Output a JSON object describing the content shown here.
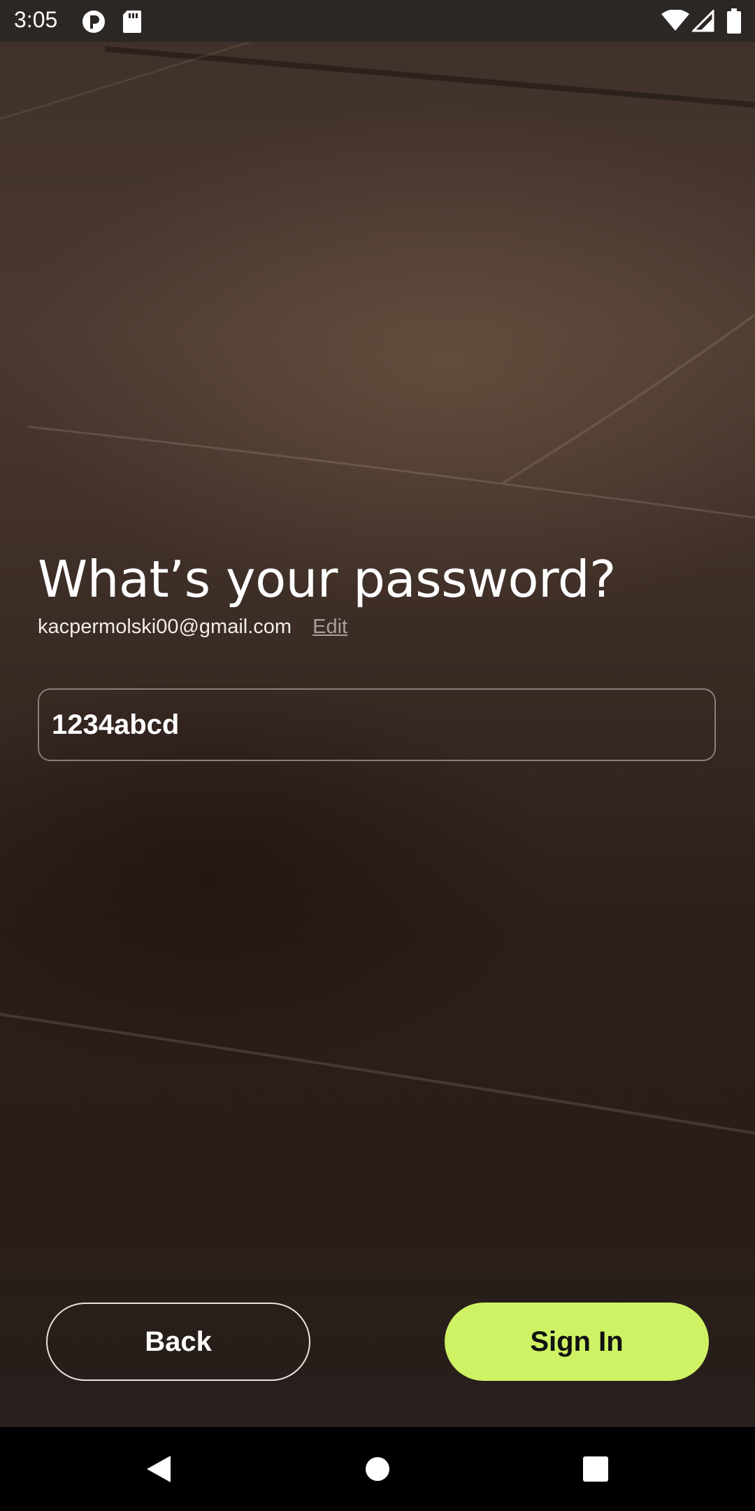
{
  "status_bar": {
    "time": "3:05",
    "left_icons": [
      "notification-p-icon",
      "sd-card-icon"
    ],
    "right_icons": [
      "wifi-icon",
      "cell-signal-icon",
      "battery-icon"
    ]
  },
  "main": {
    "title": "What’s your password?",
    "email": "kacpermolski00@gmail.com",
    "edit_label": "Edit",
    "password_value": "1234abcd"
  },
  "actions": {
    "back_label": "Back",
    "sign_in_label": "Sign In"
  },
  "nav_bar": {
    "items": [
      "back-triangle-icon",
      "home-circle-icon",
      "recents-square-icon"
    ]
  },
  "colors": {
    "accent": "#cef264",
    "nav_background": "#000000"
  }
}
